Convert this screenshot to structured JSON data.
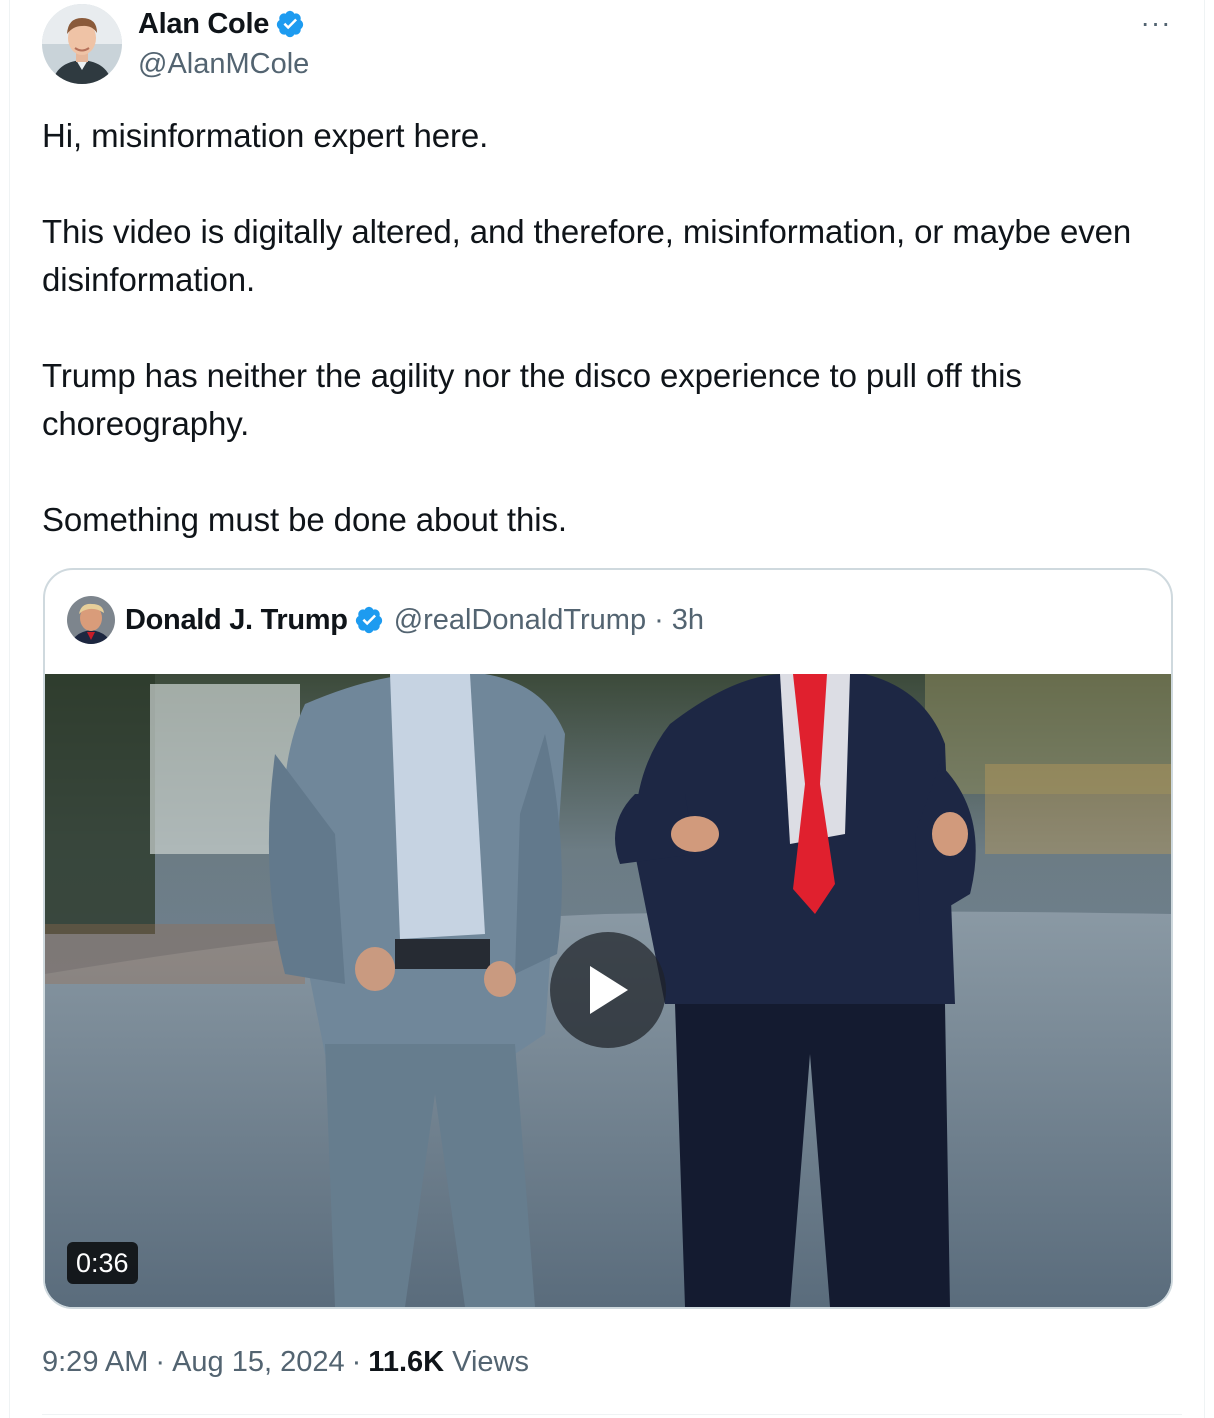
{
  "author": {
    "name": "Alan Cole",
    "handle": "@AlanMCole",
    "verified_color": "#1d9bf0"
  },
  "more_icon": "more-horizontal-icon",
  "more_label": "···",
  "tweet": {
    "paragraphs": [
      "Hi, misinformation expert here.",
      "This video is digitally altered, and therefore, misinformation, or maybe even disinformation.",
      "Trump has neither the agility nor the disco experience to pull off this choreography.",
      "Something must be done about this."
    ]
  },
  "quote": {
    "name": "Donald J. Trump",
    "handle": "@realDonaldTrump",
    "separator": "·",
    "time": "3h",
    "video_duration": "0:36",
    "play_icon": "play-icon"
  },
  "meta": {
    "time": "9:29 AM",
    "separator": "·",
    "date": "Aug 15, 2024",
    "views_count": "11.6K",
    "views_label": "Views"
  },
  "colors": {
    "text": "#0f1419",
    "secondary": "#536471",
    "border": "#cfd9de",
    "accent": "#1d9bf0",
    "tie": "#e0202e"
  }
}
